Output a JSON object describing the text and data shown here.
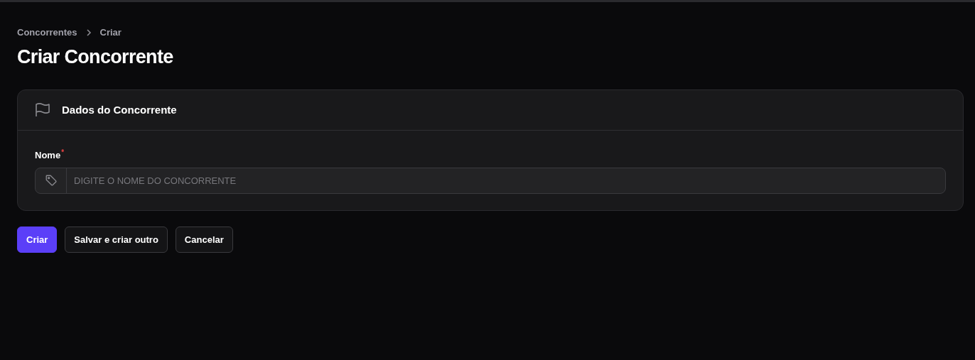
{
  "breadcrumbs": [
    {
      "label": "Concorrentes"
    },
    {
      "label": "Criar"
    }
  ],
  "page_title": "Criar Concorrente",
  "section": {
    "title": "Dados do Concorrente",
    "field": {
      "label": "Nome",
      "required_mark": "*",
      "placeholder": "DIGITE O NOME DO CONCORRENTE"
    }
  },
  "buttons": [
    {
      "label": "Criar",
      "kind": "primary"
    },
    {
      "label": "Salvar e criar outro",
      "kind": "secondary"
    },
    {
      "label": "Cancelar",
      "kind": "secondary"
    }
  ]
}
